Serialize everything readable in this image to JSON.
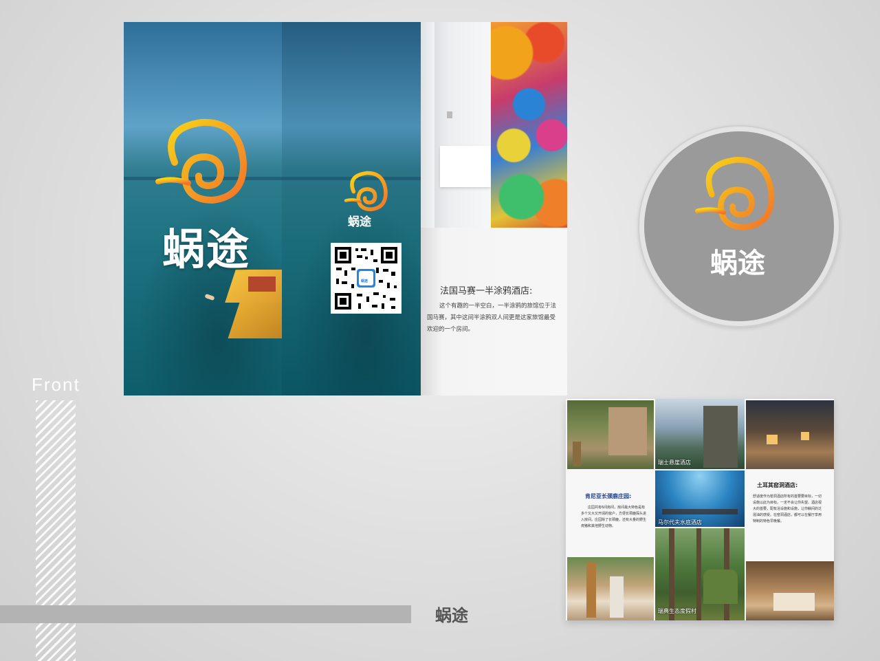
{
  "brand": "蜗途",
  "front_label": "Front",
  "qr": {
    "badge_text": "蜗途"
  },
  "article": {
    "title": "法国马赛一半涂鸦酒店:",
    "body": "这个有趣的一半空白，一半涂鸦的旅馆位于法国马赛，其中这间半涂鸦双人间更是这家旅馆最受欢迎的一个房间。"
  },
  "thumbs": {
    "swiss_caption": "瑞士悬崖酒店",
    "maldives_caption": "马尔代夫水底酒店",
    "sweden_caption": "瑞典生态度假村",
    "kenya_title": "肯尼亚长颈鹿庄园:",
    "kenya_body": "庄园共有6间房间，房间最大特色是有多个又大又开阔的窗户，方便长颈鹿探头进入房间。庄园除了长颈鹿，还有大量的野生疣猪和其他野生动物。",
    "turkey_title": "土耳其窑洞酒店:",
    "turkey_body": "舒适度作为窑洞酒店所有的首要要目标，一切设施以此为目标，一定不会让你失望。酒店视大的首要，配有浴设施和设施，让你躺间的泛混油的感受。在窑洞酒店，都可以在餐厅享用特制的特色早晚餐。"
  },
  "colors": {
    "logo_start": "#f7d21a",
    "logo_end": "#f0742b",
    "title_blue": "#1a3d8f"
  }
}
